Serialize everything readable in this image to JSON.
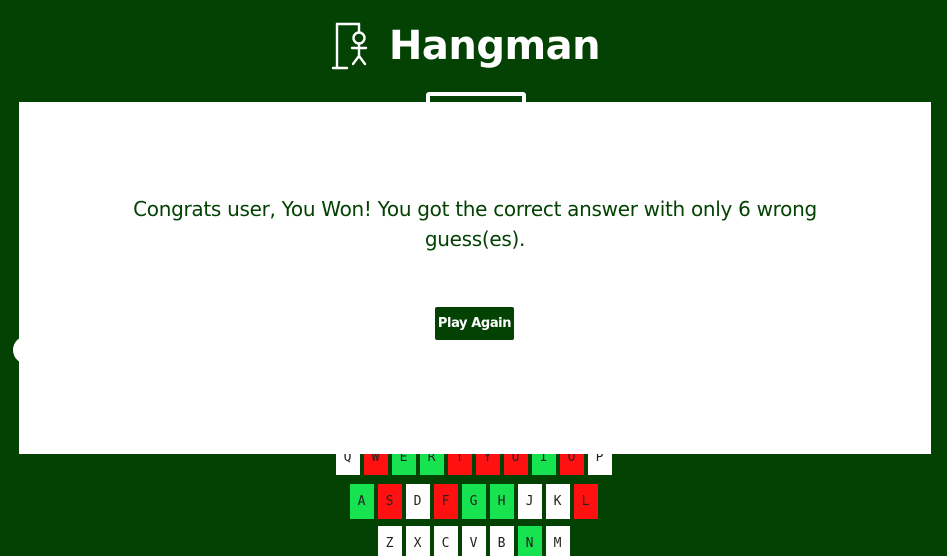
{
  "header": {
    "title": "Hangman",
    "logo_icon": "hangman-gallows-icon"
  },
  "modal": {
    "message": "Congrats user, You Won! You got the correct answer with only 6 wrong guess(es).",
    "play_again_label": "Play Again"
  },
  "colors": {
    "background": "#034203",
    "modal": "#ffffff",
    "correct": "#16e34f",
    "wrong": "#ff1111",
    "unused": "#ffffff"
  },
  "keyboard": {
    "rows": [
      [
        {
          "letter": "Q",
          "state": "unused"
        },
        {
          "letter": "W",
          "state": "wrong"
        },
        {
          "letter": "E",
          "state": "correct"
        },
        {
          "letter": "R",
          "state": "correct"
        },
        {
          "letter": "T",
          "state": "wrong"
        },
        {
          "letter": "Y",
          "state": "wrong"
        },
        {
          "letter": "U",
          "state": "wrong"
        },
        {
          "letter": "I",
          "state": "correct"
        },
        {
          "letter": "O",
          "state": "wrong"
        },
        {
          "letter": "P",
          "state": "unused"
        }
      ],
      [
        {
          "letter": "A",
          "state": "correct"
        },
        {
          "letter": "S",
          "state": "wrong"
        },
        {
          "letter": "D",
          "state": "unused"
        },
        {
          "letter": "F",
          "state": "wrong"
        },
        {
          "letter": "G",
          "state": "correct"
        },
        {
          "letter": "H",
          "state": "correct"
        },
        {
          "letter": "J",
          "state": "unused"
        },
        {
          "letter": "K",
          "state": "unused"
        },
        {
          "letter": "L",
          "state": "wrong"
        }
      ],
      [
        {
          "letter": "Z",
          "state": "unused"
        },
        {
          "letter": "X",
          "state": "unused"
        },
        {
          "letter": "C",
          "state": "unused"
        },
        {
          "letter": "V",
          "state": "unused"
        },
        {
          "letter": "B",
          "state": "unused"
        },
        {
          "letter": "N",
          "state": "correct"
        },
        {
          "letter": "M",
          "state": "unused"
        }
      ]
    ]
  }
}
